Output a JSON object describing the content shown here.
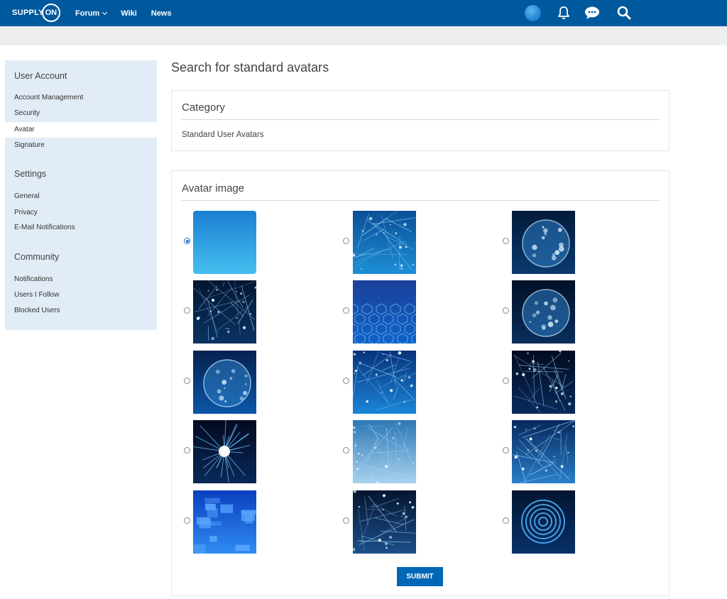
{
  "header": {
    "logo_text": "SUPPLY",
    "logo_ring_text": "ON",
    "nav": [
      {
        "label": "Forum",
        "has_dropdown": true
      },
      {
        "label": "Wiki",
        "has_dropdown": false
      },
      {
        "label": "News",
        "has_dropdown": false
      }
    ],
    "icons": [
      "user-avatar",
      "bell-icon",
      "chat-icon",
      "search-icon"
    ],
    "bar_color": "#00599c"
  },
  "sidebar": {
    "sections": [
      {
        "heading": "User Account",
        "items": [
          "Account Management",
          "Security",
          "Avatar",
          "Signature"
        ]
      },
      {
        "heading": "Settings",
        "items": [
          "General",
          "Privacy",
          "E-Mail Notifications"
        ]
      },
      {
        "heading": "Community",
        "items": [
          "Notifications",
          "Users I Follow",
          "Blocked Users"
        ]
      }
    ],
    "active_item": "Avatar"
  },
  "main": {
    "title": "Search for standard avatars",
    "category": {
      "title": "Category",
      "value": "Standard User Avatars"
    },
    "avatar_image": {
      "title": "Avatar image",
      "selected_index": 0,
      "images": [
        "solid-blue-gradient",
        "circuit-lines",
        "earth-globe",
        "network-mesh",
        "hexagon-grid",
        "digital-globe",
        "particle-sphere",
        "wave-mesh",
        "circuit-board-3d",
        "light-burst",
        "light-wave-white",
        "tech-city",
        "blue-cubes",
        "sparkle-particles",
        "concentric-rings"
      ]
    },
    "submit_label": "SUBMIT"
  }
}
